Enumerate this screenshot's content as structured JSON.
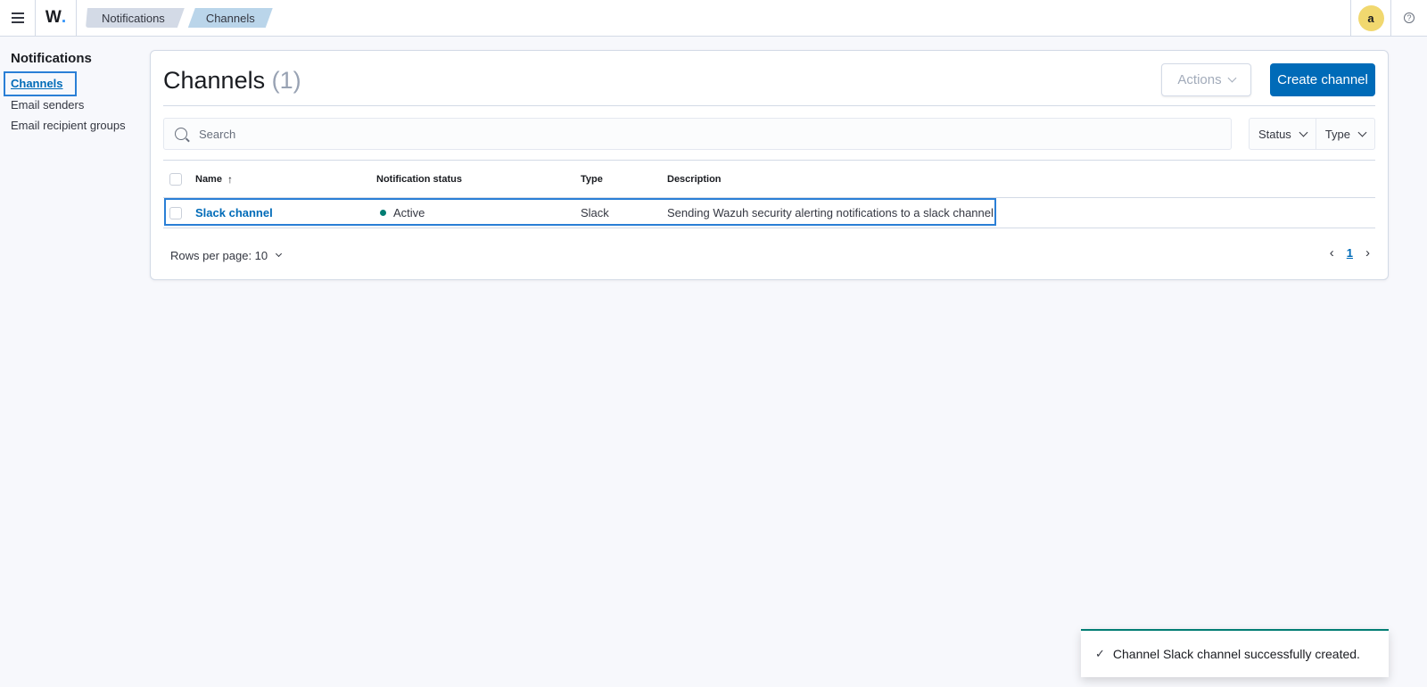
{
  "header": {
    "logo_text": "W",
    "logo_dot": ".",
    "breadcrumbs": [
      {
        "label": "Notifications"
      },
      {
        "label": "Channels"
      }
    ],
    "avatar_initial": "a",
    "help_icon_glyph": "?"
  },
  "sidebar": {
    "title": "Notifications",
    "items": [
      {
        "label": "Channels",
        "active": true
      },
      {
        "label": "Email senders",
        "active": false
      },
      {
        "label": "Email recipient groups",
        "active": false
      }
    ]
  },
  "main": {
    "title": "Channels",
    "count": "(1)",
    "actions_label": "Actions",
    "create_label": "Create channel",
    "search": {
      "placeholder": "Search",
      "value": ""
    },
    "filters": [
      {
        "label": "Status"
      },
      {
        "label": "Type"
      }
    ],
    "table": {
      "columns": [
        "Name",
        "Notification status",
        "Type",
        "Description"
      ],
      "sort_indicator": "↑",
      "rows": [
        {
          "name": "Slack channel",
          "status": "Active",
          "status_color": "#017d73",
          "type": "Slack",
          "description": "Sending Wazuh security alerting notifications to a slack channel"
        }
      ]
    },
    "pagination": {
      "rows_per_page_label": "Rows per page: 10",
      "current_page": "1",
      "prev_glyph": "‹",
      "next_glyph": "›"
    }
  },
  "toast": {
    "check_glyph": "✓",
    "message": "Channel Slack channel successfully created.",
    "accent": "#017d73"
  },
  "colors": {
    "primary": "#006bb8",
    "highlight": "#2a7fd6"
  }
}
